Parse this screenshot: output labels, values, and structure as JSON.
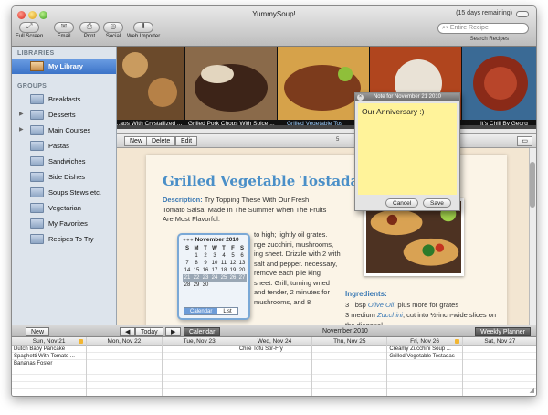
{
  "window": {
    "title": "YummySoup!",
    "trial": "(15 days remaining)"
  },
  "toolbar": {
    "buttons": [
      {
        "label": "Full Screen",
        "icon": "fullscreen-icon",
        "glyph": "⤢"
      },
      {
        "label": "Email",
        "icon": "email-icon",
        "glyph": "✉"
      },
      {
        "label": "Print",
        "icon": "print-icon",
        "glyph": "⎙"
      },
      {
        "label": "Social",
        "icon": "social-icon",
        "glyph": "◎"
      },
      {
        "label": "Web Importer",
        "icon": "web-importer-icon",
        "glyph": "⬇"
      }
    ],
    "search_placeholder": "Entire Recipe",
    "search_label": "Search Recipes"
  },
  "sidebar": {
    "libraries_header": "LIBRARIES",
    "library": "My Library",
    "groups_header": "GROUPS",
    "groups": [
      {
        "label": "Breakfasts",
        "disclosure": false
      },
      {
        "label": "Desserts",
        "disclosure": true
      },
      {
        "label": "Main Courses",
        "disclosure": true
      },
      {
        "label": "Pastas",
        "disclosure": false
      },
      {
        "label": "Sandwiches",
        "disclosure": false
      },
      {
        "label": "Side Dishes",
        "disclosure": false
      },
      {
        "label": "Soups Stews etc.",
        "disclosure": false
      },
      {
        "label": "Vegetarian",
        "disclosure": false
      },
      {
        "label": "My Favorites",
        "disclosure": false
      },
      {
        "label": "Recipes To Try",
        "disclosure": false
      }
    ]
  },
  "strip": {
    "captions": [
      "...aps With Crystallized ...",
      "Grilled Pork Chops With Spice ...",
      "Grilled Vegetable Tos",
      "",
      "It's Chili By Georg"
    ],
    "selected_index": 2
  },
  "recipe_toolbar": {
    "new": "New",
    "delete": "Delete",
    "edit": "Edit",
    "mid": "5"
  },
  "recipe": {
    "title": "Grilled Vegetable Tostadas",
    "description_label": "Description:",
    "description": "Try Topping These With Our Fresh Tomato Salsa, Made In The Summer When The Fruits Are Most Flavorful.",
    "steps": "to high; lightly oil grates. nge zucchini, mushrooms, ing sheet. Drizzle with 2 with salt and pepper. necessary, remove each pile king sheet. Grill, turning wned and tender, 2 minutes for mushrooms, and 8",
    "ingredients_header": "Ingredients:",
    "ingredients": [
      {
        "qty": "3 Tbsp",
        "item": "Olive Oil",
        "note": ", plus more for grates"
      },
      {
        "qty": "3 medium",
        "item": "Zucchini",
        "note": ", cut into ½-inch-wide slices on the diagonal"
      }
    ]
  },
  "note": {
    "header": "Note for November 21 2010",
    "text": "Our Anniversary :)",
    "cancel": "Cancel",
    "save": "Save"
  },
  "mini_calendar": {
    "month": "November 2010",
    "days": [
      "S",
      "M",
      "T",
      "W",
      "T",
      "F",
      "S"
    ],
    "rows": [
      [
        "",
        "1",
        "2",
        "3",
        "4",
        "5",
        "6"
      ],
      [
        "7",
        "8",
        "9",
        "10",
        "11",
        "12",
        "13"
      ],
      [
        "14",
        "15",
        "16",
        "17",
        "18",
        "19",
        "20"
      ],
      [
        "21",
        "22",
        "23",
        "24",
        "25",
        "26",
        "27"
      ],
      [
        "28",
        "29",
        "30",
        "",
        "",
        "",
        ""
      ]
    ],
    "highlight_row": 3,
    "tabs": [
      "Calendar",
      "List"
    ]
  },
  "calendar_bar": {
    "new": "New",
    "prev": "◀",
    "today": "Today",
    "next": "▶",
    "calendar": "Calendar",
    "month": "November 2010",
    "weekly_planner": "Weekly Planner"
  },
  "week": [
    {
      "label": "Sun, Nov 21",
      "flag": true,
      "events": [
        "Dutch Baby Pancake",
        "Spaghetti With Tomato ...",
        "Bananas Foster"
      ]
    },
    {
      "label": "Mon, Nov 22",
      "flag": false,
      "events": []
    },
    {
      "label": "Tue, Nov 23",
      "flag": false,
      "events": []
    },
    {
      "label": "Wed, Nov 24",
      "flag": false,
      "events": [
        "Chile Tofu Stir-Fry"
      ]
    },
    {
      "label": "Thu, Nov 25",
      "flag": false,
      "events": []
    },
    {
      "label": "Fri, Nov 26",
      "flag": true,
      "events": [
        "Creamy Zucchini Soup ...",
        "Grilled Vegetable Tostadas"
      ]
    },
    {
      "label": "Sat, Nov 27",
      "flag": false,
      "events": []
    }
  ],
  "colors": {
    "accent": "#3b79b4",
    "selection": "#3b73c8",
    "note": "#fff39a"
  }
}
